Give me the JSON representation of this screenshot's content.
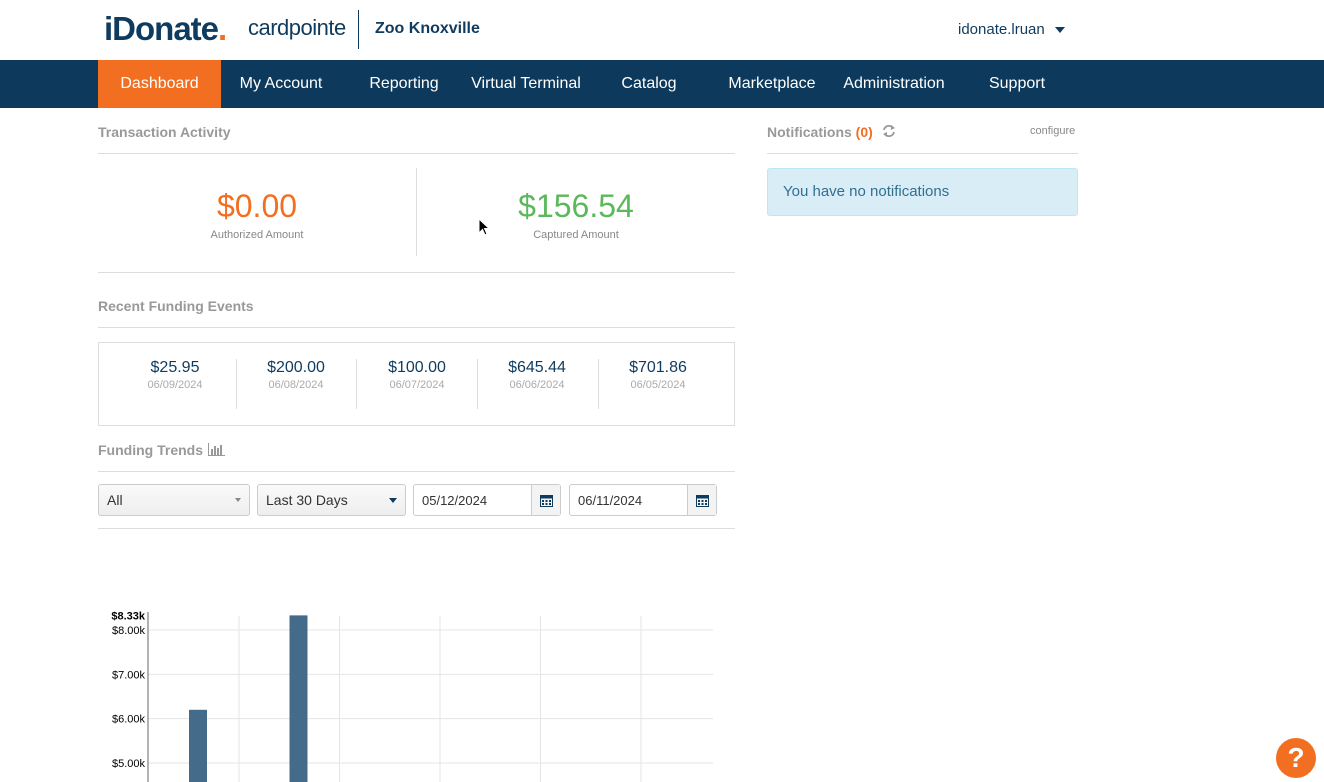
{
  "header": {
    "logo_primary": "iDonate",
    "logo_secondary": "cardpointe",
    "merchant_name": "Zoo Knoxville",
    "user_name": "idonate.lruan"
  },
  "nav": {
    "items": [
      {
        "label": "Dashboard",
        "active": true
      },
      {
        "label": "My Account"
      },
      {
        "label": "Reporting"
      },
      {
        "label": "Virtual Terminal"
      },
      {
        "label": "Catalog"
      },
      {
        "label": "Marketplace"
      },
      {
        "label": "Administration"
      },
      {
        "label": "Support"
      }
    ]
  },
  "transaction_activity": {
    "title": "Transaction Activity",
    "authorized": {
      "amount": "$0.00",
      "label": "Authorized Amount",
      "color": "#f26f21"
    },
    "captured": {
      "amount": "$156.54",
      "label": "Captured Amount",
      "color": "#5cb85c"
    }
  },
  "funding_events": {
    "title": "Recent Funding Events",
    "items": [
      {
        "amount": "$25.95",
        "date": "06/09/2024"
      },
      {
        "amount": "$200.00",
        "date": "06/08/2024"
      },
      {
        "amount": "$100.00",
        "date": "06/07/2024"
      },
      {
        "amount": "$645.44",
        "date": "06/06/2024"
      },
      {
        "amount": "$701.86",
        "date": "06/05/2024"
      }
    ]
  },
  "funding_trends": {
    "title": "Funding Trends",
    "icon": "bar-chart-icon",
    "filter_select": "All",
    "range_select": "Last 30 Days",
    "start_date": "05/12/2024",
    "end_date": "06/11/2024"
  },
  "notifications": {
    "title": "Notifications",
    "count": "(0)",
    "configure_label": "configure",
    "empty_message": "You have no notifications"
  },
  "help": {
    "label": "?"
  },
  "chart_data": {
    "type": "bar",
    "title": "",
    "xlabel": "",
    "ylabel": "",
    "y_ticks": [
      "$8.33k",
      "$8.00k",
      "$7.00k",
      "$6.00k",
      "$5.00k"
    ],
    "y_tick_values": [
      8330,
      8000,
      7000,
      6000,
      5000
    ],
    "ylim": [
      5000,
      8330
    ],
    "grid": true,
    "bars": [
      {
        "slot": 1,
        "value": 6200
      },
      {
        "slot": 2,
        "value": 8330
      }
    ],
    "bar_color": "#456b8a"
  },
  "colors": {
    "nav_bg": "#0d3a5c",
    "accent": "#f26f21",
    "brand": "#0f3b5f"
  }
}
